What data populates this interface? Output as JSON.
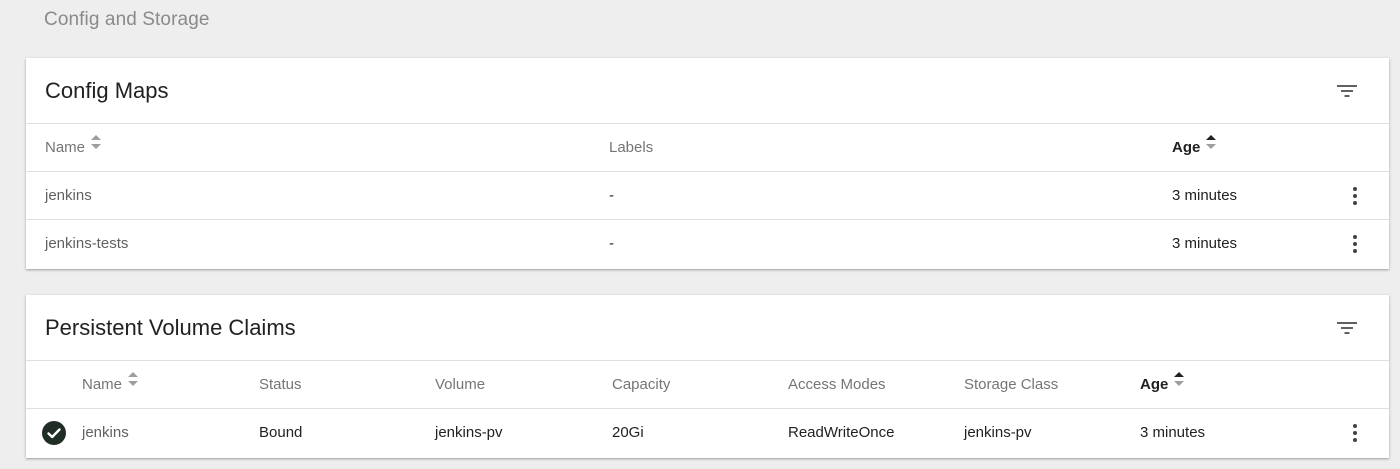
{
  "page": {
    "section_title": "Config and Storage"
  },
  "config_maps": {
    "title": "Config Maps",
    "columns": {
      "name": "Name",
      "labels": "Labels",
      "age": "Age"
    },
    "rows": [
      {
        "name": "jenkins",
        "labels": "-",
        "age": "3 minutes"
      },
      {
        "name": "jenkins-tests",
        "labels": "-",
        "age": "3 minutes"
      }
    ]
  },
  "pvc": {
    "title": "Persistent Volume Claims",
    "columns": {
      "name": "Name",
      "status": "Status",
      "volume": "Volume",
      "capacity": "Capacity",
      "access_modes": "Access Modes",
      "storage_class": "Storage Class",
      "age": "Age"
    },
    "rows": [
      {
        "name": "jenkins",
        "status": "Bound",
        "volume": "jenkins-pv",
        "capacity": "20Gi",
        "access_modes": "ReadWriteOnce",
        "storage_class": "jenkins-pv",
        "age": "3 minutes"
      }
    ]
  },
  "icons": {
    "filter": "filter-list-icon",
    "sort": "sort-icon",
    "menu": "more-vert-icon",
    "status_ok": "check-circle-icon"
  },
  "colors": {
    "status_ok": "#1f2d25",
    "background": "#eeeeee"
  }
}
